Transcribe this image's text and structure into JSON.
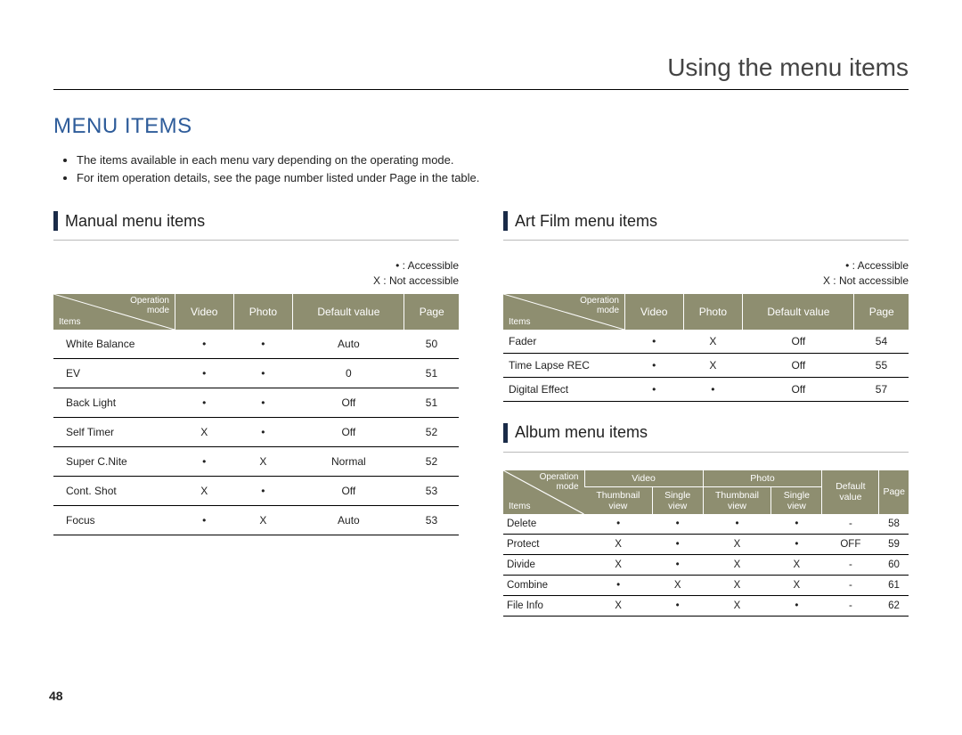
{
  "header": {
    "title": "Using the menu items"
  },
  "section_heading": "MENU ITEMS",
  "bullets": [
    "The items available in each menu vary depending on the operating mode.",
    "For item operation details, see the page number listed under Page in the table."
  ],
  "legend": {
    "accessible": "• : Accessible",
    "not_accessible": "X : Not accessible"
  },
  "corner": {
    "top": "Operation\nmode",
    "bottom": "Items"
  },
  "table_headers_basic": [
    "Video",
    "Photo",
    "Default value",
    "Page"
  ],
  "manual": {
    "title": "Manual menu items",
    "rows": [
      {
        "name": "White Balance",
        "video": "•",
        "photo": "•",
        "default": "Auto",
        "page": "50"
      },
      {
        "name": "EV",
        "video": "•",
        "photo": "•",
        "default": "0",
        "page": "51"
      },
      {
        "name": "Back Light",
        "video": "•",
        "photo": "•",
        "default": "Off",
        "page": "51"
      },
      {
        "name": "Self Timer",
        "video": "X",
        "photo": "•",
        "default": "Off",
        "page": "52"
      },
      {
        "name": "Super C.Nite",
        "video": "•",
        "photo": "X",
        "default": "Normal",
        "page": "52"
      },
      {
        "name": "Cont. Shot",
        "video": "X",
        "photo": "•",
        "default": "Off",
        "page": "53"
      },
      {
        "name": "Focus",
        "video": "•",
        "photo": "X",
        "default": "Auto",
        "page": "53"
      }
    ]
  },
  "artfilm": {
    "title": "Art Film menu items",
    "rows": [
      {
        "name": "Fader",
        "video": "•",
        "photo": "X",
        "default": "Off",
        "page": "54"
      },
      {
        "name": "Time Lapse REC",
        "video": "•",
        "photo": "X",
        "default": "Off",
        "page": "55"
      },
      {
        "name": "Digital Effect",
        "video": "•",
        "photo": "•",
        "default": "Off",
        "page": "57"
      }
    ]
  },
  "album": {
    "title": "Album menu items",
    "group_headers": [
      "Video",
      "Photo"
    ],
    "sub_headers": [
      "Thumbnail view",
      "Single view",
      "Thumbnail view",
      "Single view",
      "Default value",
      "Page"
    ],
    "rows": [
      {
        "name": "Delete",
        "c": [
          "•",
          "•",
          "•",
          "•",
          "-",
          "58"
        ]
      },
      {
        "name": "Protect",
        "c": [
          "X",
          "•",
          "X",
          "•",
          "OFF",
          "59"
        ]
      },
      {
        "name": "Divide",
        "c": [
          "X",
          "•",
          "X",
          "X",
          "-",
          "60"
        ]
      },
      {
        "name": "Combine",
        "c": [
          "•",
          "X",
          "X",
          "X",
          "-",
          "61"
        ]
      },
      {
        "name": "File Info",
        "c": [
          "X",
          "•",
          "X",
          "•",
          "-",
          "62"
        ]
      }
    ]
  },
  "page_number": "48"
}
